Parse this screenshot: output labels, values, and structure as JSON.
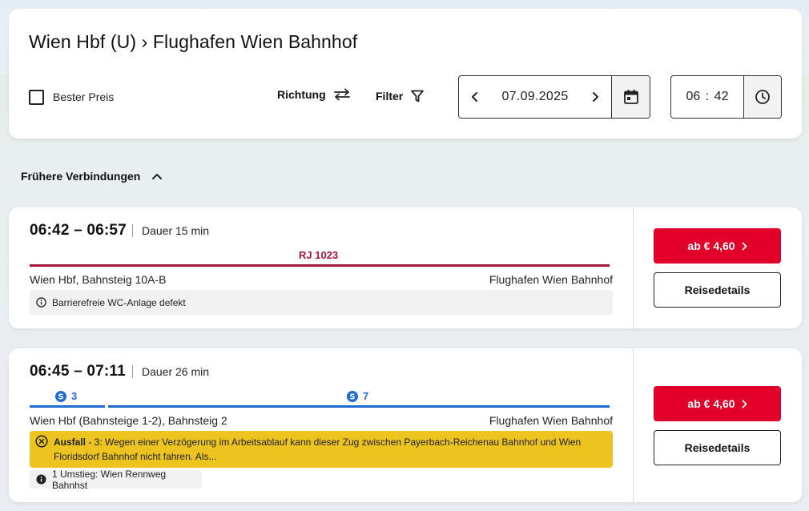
{
  "search": {
    "route_title": "Wien Hbf (U) › Flughafen Wien Bahnhof",
    "best_price_label": "Bester Preis",
    "best_price_checked": false,
    "direction_label": "Richtung",
    "filter_label": "Filter",
    "date": "07.09.2025",
    "time": "06 : 42"
  },
  "earlier_label": "Frühere Verbindungen",
  "connections": [
    {
      "times": "06:42 – 06:57",
      "duration": "Dauer 15 min",
      "train": "RJ 1023",
      "line_color": "#a6163a",
      "from": "Wien Hbf, Bahnsteig 10A-B",
      "to": "Flughafen Wien Bahnhof",
      "info": "Barrierefreie WC-Anlage defekt",
      "price": "ab € 4,60",
      "details_label": "Reisedetails"
    },
    {
      "times": "06:45 – 07:11",
      "duration": "Dauer 26 min",
      "segments": [
        {
          "line": "3",
          "icon": "s-bahn-icon"
        },
        {
          "line": "7",
          "icon": "s-bahn-icon"
        }
      ],
      "line_color": "#1e6ad6",
      "from": "Wien Hbf (Bahnsteige 1-2), Bahnsteig 2",
      "to": "Flughafen Wien Bahnhof",
      "alert_title": "Ausfall",
      "alert_text": " - 3: Wegen einer Verzögerung im Arbeitsablauf kann dieser Zug zwischen Payerbach-Reichenau Bahnhof und Wien Floridsdorf Bahnhof nicht fahren. Als...",
      "info": "1 Umstieg: Wien Rennweg Bahnhst",
      "price": "ab € 4,60",
      "details_label": "Reisedetails"
    }
  ]
}
